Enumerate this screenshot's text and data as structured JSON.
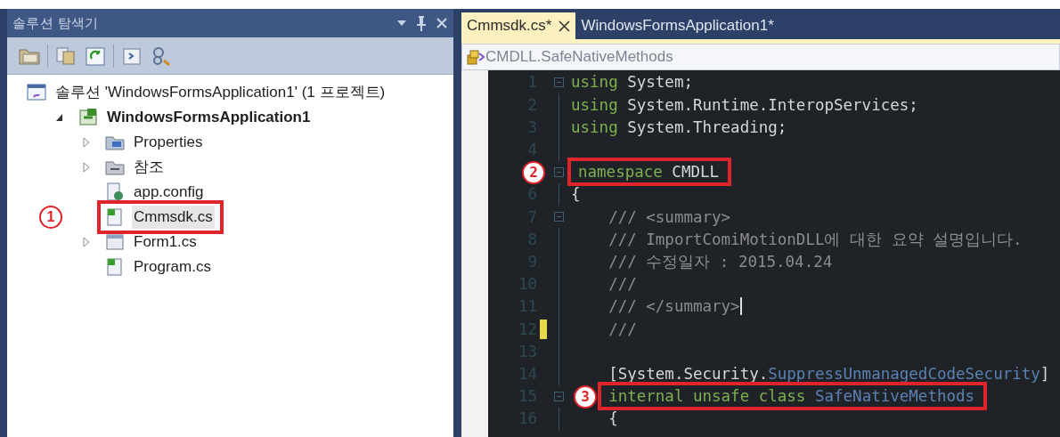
{
  "solution_explorer": {
    "title": "솔루션 탐색기",
    "tree": [
      {
        "label": "솔루션 'WindowsFormsApplication1' (1 프로젝트)",
        "kind": "solution",
        "bold": false,
        "selected": false,
        "children": [
          {
            "label": "WindowsFormsApplication1",
            "kind": "project",
            "expanded": true,
            "bold": true,
            "selected": false,
            "children": [
              {
                "label": "Properties",
                "kind": "properties",
                "expanded": false,
                "bold": false,
                "selected": false
              },
              {
                "label": "참조",
                "kind": "references",
                "expanded": false,
                "bold": false,
                "selected": false
              },
              {
                "label": "app.config",
                "kind": "config",
                "bold": false,
                "selected": false
              },
              {
                "label": "Cmmsdk.cs",
                "kind": "code",
                "bold": false,
                "selected": true,
                "marker": "1"
              },
              {
                "label": "Form1.cs",
                "kind": "form",
                "expanded": false,
                "bold": false,
                "selected": false
              },
              {
                "label": "Program.cs",
                "kind": "code",
                "bold": false,
                "selected": false
              }
            ]
          }
        ]
      }
    ]
  },
  "editor": {
    "tabs": [
      {
        "label": "Cmmsdk.cs*",
        "selected": true
      },
      {
        "label": "WindowsFormsApplication1*",
        "selected": false
      }
    ],
    "navigation": "CMDLL.SafeNativeMethods",
    "lines": [
      {
        "number": "1",
        "expanded": true,
        "tokens": [
          {
            "text": "using",
            "kind": "keyword"
          },
          {
            "text": " System;",
            "kind": "plain"
          }
        ]
      },
      {
        "number": "2",
        "tokens": [
          {
            "text": "using",
            "kind": "keyword"
          },
          {
            "text": " System.Runtime.InteropServices;",
            "kind": "plain"
          }
        ]
      },
      {
        "number": "3",
        "tokens": [
          {
            "text": "using",
            "kind": "keyword"
          },
          {
            "text": " System.Threading;",
            "kind": "plain"
          }
        ]
      },
      {
        "number": "4"
      },
      {
        "expanded": true,
        "marker": "2",
        "tokens": [
          {
            "text": "namespace",
            "kind": "keyword"
          },
          {
            "text": " CMDLL",
            "kind": "plain"
          }
        ]
      },
      {
        "number": "6",
        "tokens": [
          {
            "text": "{",
            "kind": "plain"
          }
        ]
      },
      {
        "number": "7",
        "expanded": true,
        "tokens": [
          {
            "text": "    /// <summary>",
            "kind": "comment"
          }
        ]
      },
      {
        "number": "8",
        "tokens": [
          {
            "text": "    /// ImportComiMotionDLL에 대한 요약 설명입니다.",
            "kind": "comment"
          }
        ]
      },
      {
        "number": "9",
        "tokens": [
          {
            "text": "    /// 수정일자 : 2015.04.24",
            "kind": "comment"
          }
        ]
      },
      {
        "number": "10",
        "tokens": [
          {
            "text": "    ///",
            "kind": "comment"
          }
        ]
      },
      {
        "number": "11",
        "caret": true,
        "tokens": [
          {
            "text": "    /// </summary>",
            "kind": "comment"
          }
        ]
      },
      {
        "number": "12",
        "changed": true,
        "tokens": [
          {
            "text": "    ///",
            "kind": "comment"
          }
        ]
      },
      {
        "number": "13"
      },
      {
        "number": "14",
        "tokens": [
          {
            "text": "    [System.Security.",
            "kind": "plain"
          },
          {
            "text": "SuppressUnmanagedCodeSecurity",
            "kind": "type"
          },
          {
            "text": "]",
            "kind": "plain"
          }
        ]
      },
      {
        "number": "15",
        "expanded": true,
        "marker": "3",
        "tokens": [
          {
            "text": "    internal unsafe class",
            "kind": "keyword"
          },
          {
            "text": " SafeNativeMethods",
            "kind": "type"
          }
        ]
      },
      {
        "number": "16",
        "tokens": [
          {
            "text": "    {",
            "kind": "plain"
          }
        ]
      }
    ]
  }
}
